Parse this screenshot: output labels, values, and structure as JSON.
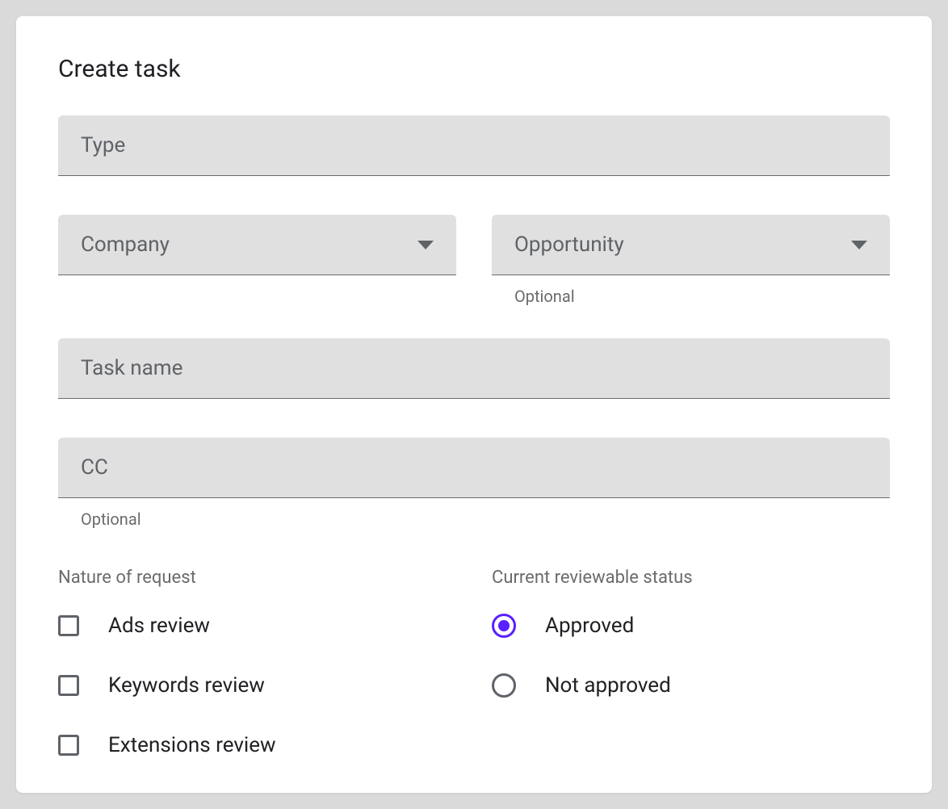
{
  "title": "Create task",
  "fields": {
    "type": {
      "label": "Type"
    },
    "company": {
      "label": "Company"
    },
    "opportunity": {
      "label": "Opportunity",
      "helper": "Optional"
    },
    "task_name": {
      "label": "Task name"
    },
    "cc": {
      "label": "CC",
      "helper": "Optional"
    }
  },
  "nature_of_request": {
    "title": "Nature of request",
    "options": [
      {
        "label": "Ads review",
        "checked": false
      },
      {
        "label": "Keywords review",
        "checked": false
      },
      {
        "label": "Extensions review",
        "checked": false
      }
    ]
  },
  "reviewable_status": {
    "title": "Current reviewable status",
    "options": [
      {
        "label": "Approved",
        "selected": true
      },
      {
        "label": "Not approved",
        "selected": false
      }
    ]
  }
}
